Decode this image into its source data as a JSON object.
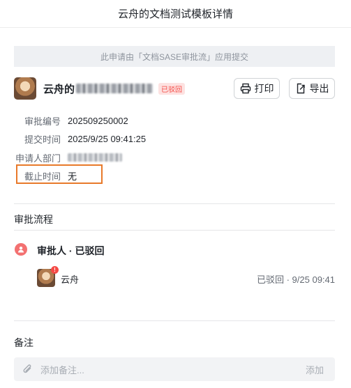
{
  "header": {
    "title": "云舟的文档测试模板详情"
  },
  "source_banner": "此申请由「文档SASE审批流」应用提交",
  "request": {
    "title_prefix": "云舟的",
    "status_tag": "已驳回",
    "print_label": "打印",
    "export_label": "导出"
  },
  "fields": {
    "approval_no_label": "审批编号",
    "approval_no_value": "202509250002",
    "submit_time_label": "提交时间",
    "submit_time_value": "2025/9/25 09:41:25",
    "dept_label": "申请人部门",
    "deadline_label": "截止时间",
    "deadline_value": "无"
  },
  "flow": {
    "section_title": "审批流程",
    "step_title": "审批人 · 已驳回",
    "approver_name": "云舟",
    "approver_badge": "!",
    "approver_status": "已驳回 · 9/25 09:41"
  },
  "remark": {
    "section_title": "备注",
    "placeholder": "添加备注...",
    "add_label": "添加"
  },
  "colors": {
    "highlight_border": "#e8792a",
    "rejected_red": "#f54a45"
  }
}
